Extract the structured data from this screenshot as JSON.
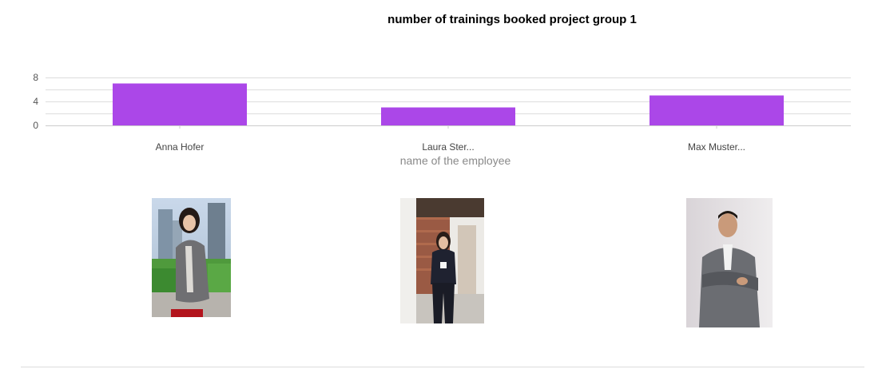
{
  "chart_data": {
    "type": "bar",
    "title": "number of trainings booked project group 1",
    "xlabel": "name of the employee",
    "ylabel": "",
    "categories": [
      "Anna Hofer",
      "Laura Ster...",
      "Max Muster..."
    ],
    "values": [
      7,
      3,
      5
    ],
    "ylim": [
      0,
      8
    ],
    "yticks": [
      "0",
      "4",
      "8"
    ],
    "bar_color": "#ab47e8",
    "grid": true,
    "legend": "none"
  },
  "photos": [
    {
      "name": "Anna Hofer",
      "description": "woman in grey blazer, city background"
    },
    {
      "name": "Laura Ster...",
      "description": "woman in dark outfit holding mug, brick wall"
    },
    {
      "name": "Max Muster...",
      "description": "man in grey suit with crossed arms"
    }
  ]
}
